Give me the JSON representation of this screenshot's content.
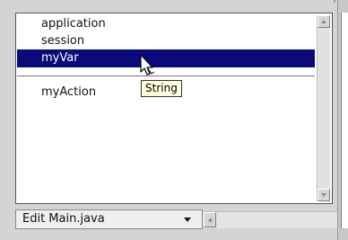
{
  "list": {
    "items": [
      {
        "label": "application",
        "selected": false
      },
      {
        "label": "session",
        "selected": false
      },
      {
        "label": "myVar",
        "selected": true
      },
      {
        "label": "myAction",
        "selected": false
      }
    ]
  },
  "tooltip": {
    "text": "String"
  },
  "bottom_bar": {
    "select_value": "Edit Main.java"
  },
  "colors": {
    "selection": "#0a0a7a",
    "tooltip_bg": "#ffffdd",
    "background": "#d4d4d4"
  },
  "icons": [
    "arrow-pointer-icon",
    "chevron-up-icon",
    "chevron-down-icon",
    "dropdown-arrow-icon",
    "chevron-left-icon"
  ]
}
